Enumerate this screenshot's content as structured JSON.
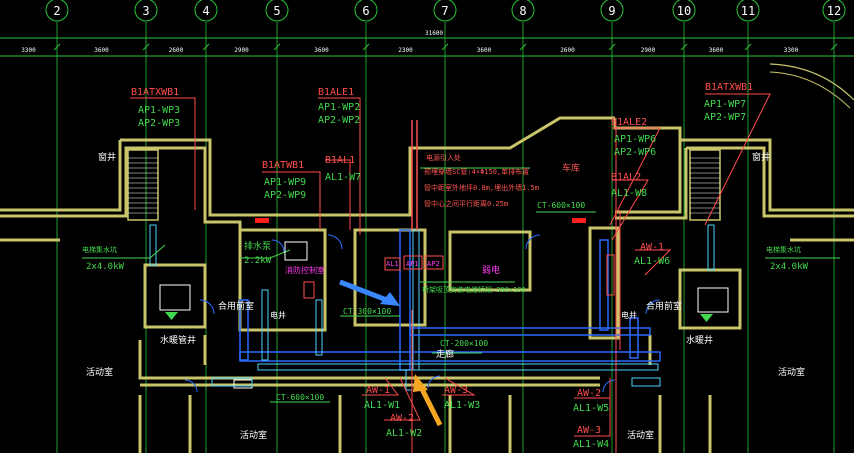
{
  "colors": {
    "background": "#000000",
    "grid": "#29c43a",
    "wall": "#c9c56a",
    "tag_red": "#ff4d4d",
    "tag_green": "#43d94f",
    "note_red": "#ff5555",
    "tray_blue": "#2a6bff",
    "tray_cyan": "#4fd1ff",
    "magenta": "#ff3cf0",
    "white": "#ffffff",
    "arrow_blue": "#3a86ff",
    "arrow_orange": "#f5a623"
  },
  "grid_axes": [
    "2",
    "3",
    "4",
    "5",
    "6",
    "7",
    "8",
    "9",
    "10",
    "11",
    "12"
  ],
  "dimensions": {
    "segments": [
      "3300",
      "3600",
      "2600",
      "2900",
      "3600",
      "2300",
      "3600",
      "2600",
      "2900",
      "3600",
      "3300"
    ],
    "total": "31600"
  },
  "panels": {
    "b1atxwb1_left": {
      "name": "B1ATXWB1",
      "l1": "AP1-WP3",
      "l2": "AP2-WP3"
    },
    "b1ale1": {
      "name": "B1ALE1",
      "l1": "AP1-WP2",
      "l2": "AP2-WP2"
    },
    "b1atwb1": {
      "name": "B1ATWB1",
      "l1": "AP1-WP9",
      "l2": "AP2-WP9"
    },
    "b1al1": {
      "name": "B1AL1",
      "l1": "AL1-W7"
    },
    "b1ale2": {
      "name": "B1ALE2",
      "l1": "AP1-WP6",
      "l2": "AP2-WP6"
    },
    "b1al2": {
      "name": "B1AL2",
      "l1": "AL1-W8"
    },
    "b1atxwb1_right": {
      "name": "B1ATXWB1",
      "l1": "AP1-WP7",
      "l2": "AP2-WP7"
    },
    "aw1_right": {
      "name": "AW-1",
      "l1": "AL1-W6"
    },
    "aw1_bottom": {
      "name": "AW-1",
      "l1": "AL1-W1"
    },
    "aw2_bottom": {
      "name": "AW-2",
      "l1": "AL1-W2"
    },
    "aw3_bottom": {
      "name": "AW-3",
      "l1": "AL1-W3"
    },
    "aw2_right": {
      "name": "AW-2",
      "l1": "AL1-W5"
    },
    "aw3_right": {
      "name": "AW-3",
      "l1": "AL1-W4"
    }
  },
  "notes": {
    "cable_entry": "电源引入处",
    "conduit": "预埋穿墙SC管:4×Φ150,单排布置",
    "height1": "管中距室外地坪0.8m,埋出外墙1.5m",
    "height2": "管中心之间平行距离0.25m",
    "trunk_tray": "桥架吸顶安装电缆桥架-300×100"
  },
  "trays": {
    "ct600_top": "CT-600×100",
    "ct300": "CT-300×100",
    "ct200": "CT-200×100",
    "ct600_bottom": "CT-600×100"
  },
  "rooms": {
    "garage": "车库",
    "shaft_left": "窗井",
    "shaft_right": "窗井",
    "pump_left": "电梯集水坑",
    "pump_left_kw": "2x4.0kW",
    "pump_right": "电梯集水坑",
    "pump_right_kw": "2x4.0kW",
    "sump": "排水泵",
    "sump_kw": "2.2kW",
    "room_mid": "弱电",
    "fire_room": "消防控制室",
    "shared_left": "合用前室",
    "shared_right": "合用前室",
    "well_left": "水暖管井",
    "well_right": "水暖井",
    "corridor": "走廊",
    "activity": "活动室",
    "elec_left": "电井",
    "elec_right": "电井"
  },
  "small_labels": {
    "ap1": "AP1",
    "ap2": "AP2",
    "al1": "AL1"
  }
}
